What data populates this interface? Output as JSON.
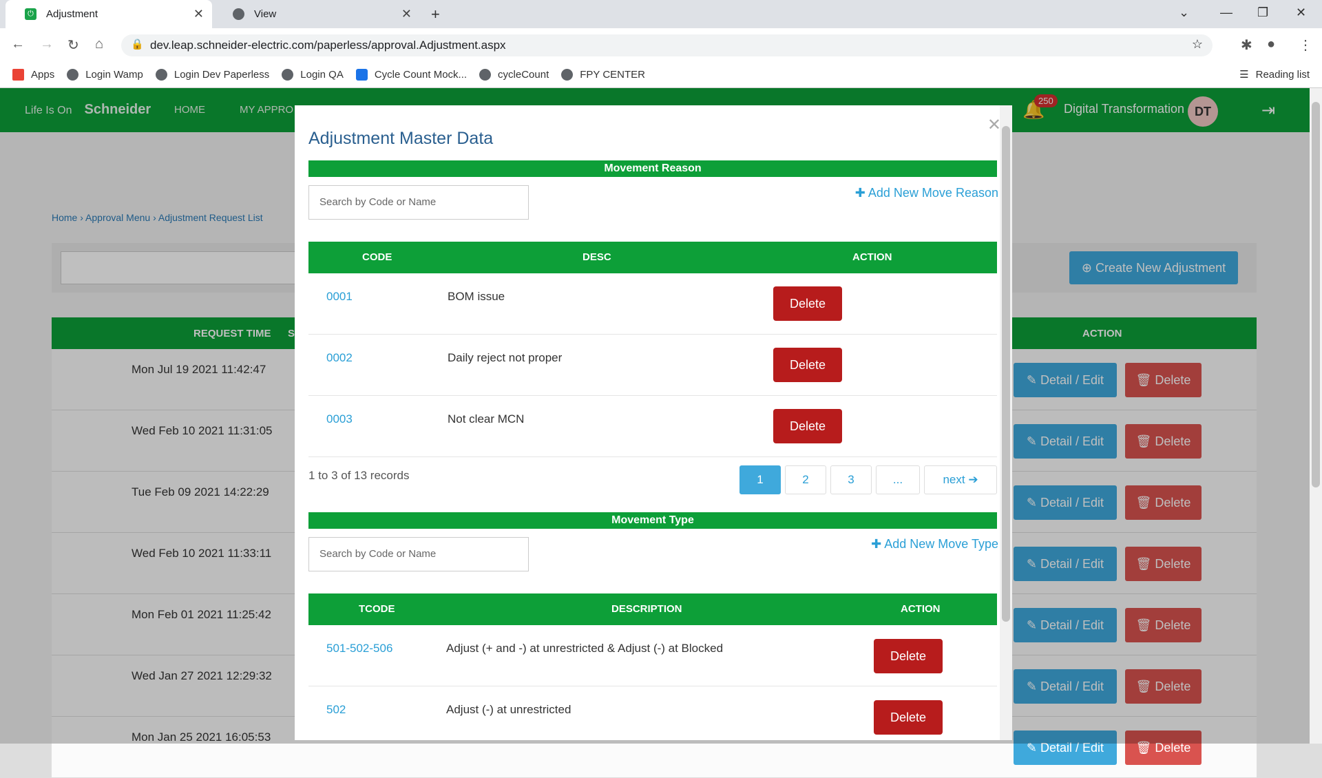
{
  "browser": {
    "tabs": [
      {
        "title": "Adjustment"
      },
      {
        "title": "View"
      }
    ],
    "url": "dev.leap.schneider-electric.com/paperless/approval.Adjustment.aspx",
    "bookmarks": [
      "Apps",
      "Login Wamp",
      "Login Dev Paperless",
      "Login QA",
      "Cycle Count Mock...",
      "cycleCount",
      "FPY CENTER"
    ],
    "reading_list": "Reading list"
  },
  "app": {
    "brand_left": "Life Is On",
    "brand_name": "Schneider",
    "nav": [
      "HOME",
      "MY APPRO"
    ],
    "notification_count": "250",
    "user_name": "Digital Transformation",
    "user_initials": "DT",
    "breadcrumb": [
      "Home",
      "Approval Menu",
      "Adjustment Request List"
    ],
    "create_button": "Create New Adjustment",
    "grid_headers": {
      "request_time": "REQUEST TIME",
      "s": "S",
      "action": "ACTION"
    },
    "rows": [
      {
        "time": "Mon Jul 19 2021 11:42:47"
      },
      {
        "time": "Wed Feb 10 2021 11:31:05"
      },
      {
        "time": "Tue Feb 09 2021 14:22:29"
      },
      {
        "time": "Wed Feb 10 2021 11:33:11"
      },
      {
        "time": "Mon Feb 01 2021 11:25:42"
      },
      {
        "time": "Wed Jan 27 2021 12:29:32"
      },
      {
        "time": "Mon Jan 25 2021 16:05:53"
      }
    ],
    "detail_label": "Detail / Edit",
    "delete_label": "Delete"
  },
  "modal": {
    "title": "Adjustment Master Data",
    "reason": {
      "section": "Movement Reason",
      "search_placeholder": "Search by Code or Name",
      "add_label": "Add New Move Reason",
      "headers": {
        "code": "CODE",
        "desc": "DESC",
        "action": "ACTION"
      },
      "rows": [
        {
          "code": "0001",
          "desc": "BOM issue"
        },
        {
          "code": "0002",
          "desc": "Daily reject not proper"
        },
        {
          "code": "0003",
          "desc": "Not clear MCN"
        }
      ],
      "records": "1 to 3 of 13 records",
      "pages": [
        "1",
        "2",
        "3",
        "..."
      ],
      "next": "next"
    },
    "type": {
      "section": "Movement Type",
      "search_placeholder": "Search by Code or Name",
      "add_label": "Add New Move Type",
      "headers": {
        "tcode": "TCODE",
        "description": "DESCRIPTION",
        "action": "ACTION"
      },
      "rows": [
        {
          "code": "501-502-506",
          "desc": "Adjust (+ and -) at unrestricted & Adjust (-) at Blocked"
        },
        {
          "code": "502",
          "desc": "Adjust (-) at unrestricted"
        }
      ]
    },
    "delete_label": "Delete"
  },
  "colors": {
    "green": "#0d9f38",
    "red": "#b71c1c",
    "blue": "#2a9fd6"
  }
}
